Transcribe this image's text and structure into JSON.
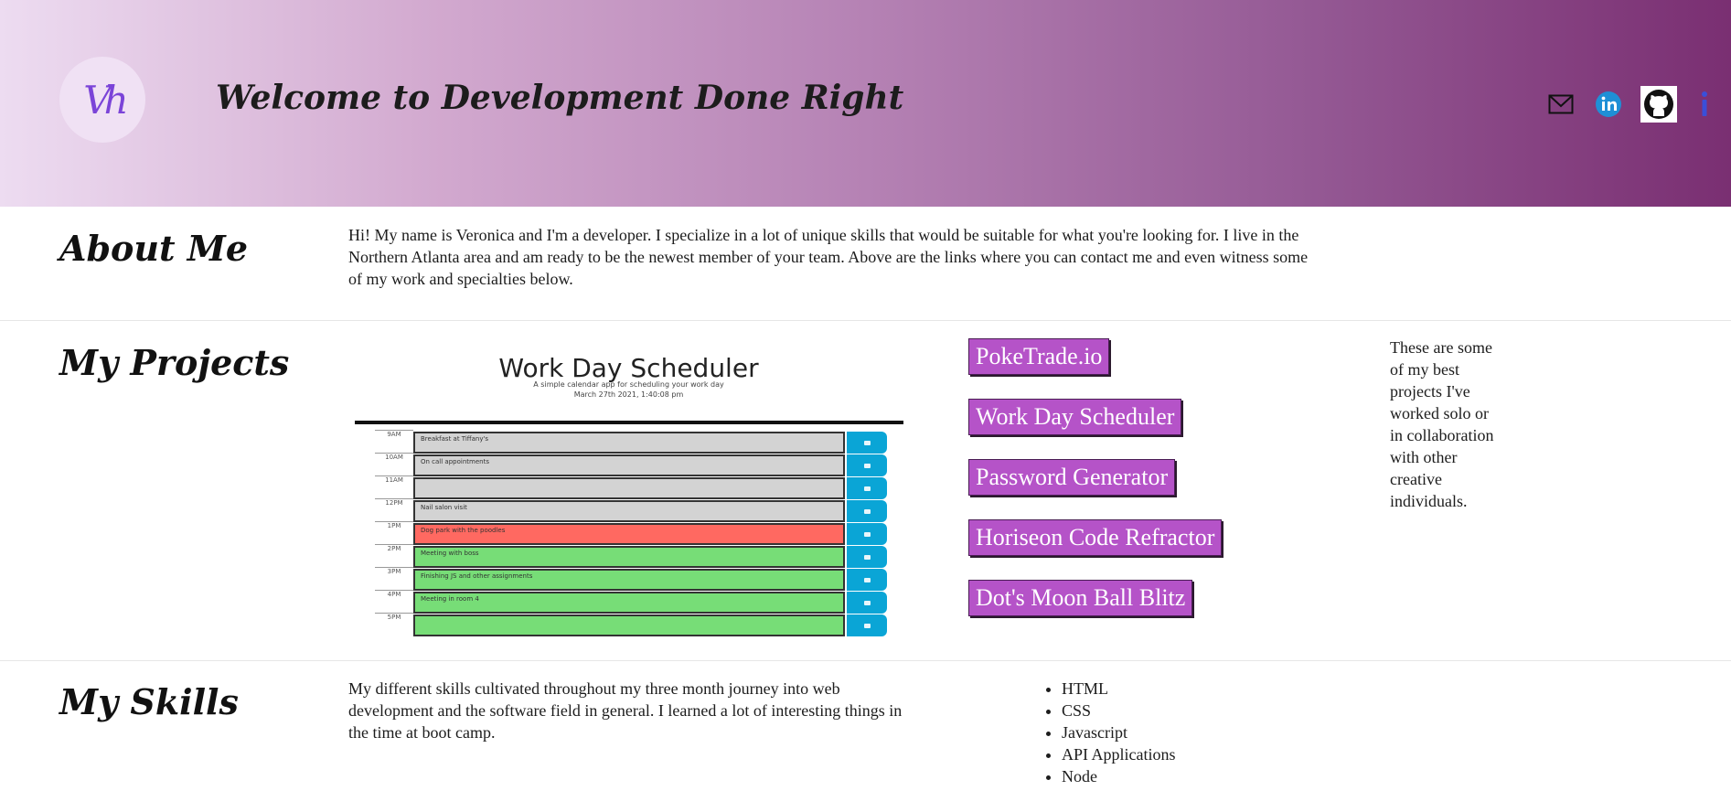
{
  "header": {
    "logo_text": "Vh",
    "title": "Welcome to Development Done Right",
    "icons": [
      "mail-icon",
      "linkedin-icon",
      "github-icon",
      "info-icon"
    ],
    "accent_colors": {
      "gradient_start": "#eddcf1",
      "gradient_end": "#7a2f72",
      "linkedin": "#1f8fd6",
      "info": "#3a4fd9"
    }
  },
  "about": {
    "heading": "About Me",
    "text": "Hi! My name is Veronica and I'm a developer. I specialize in a lot of unique skills that would be suitable for what you're looking for. I live in the Northern Atlanta area and am ready to be the newest member of your team. Above are the links where you can contact me and even witness some of my work and specialties below."
  },
  "projects": {
    "heading": "My Projects",
    "preview": {
      "title": "Work Day Scheduler",
      "subtitle": "A simple calendar app for scheduling your work day",
      "date": "March 27th 2021, 1:40:08 pm",
      "rows": [
        {
          "hour": "9AM",
          "text": "Breakfast at Tiffany's",
          "color": "#d3d3d3"
        },
        {
          "hour": "10AM",
          "text": "On call appointments",
          "color": "#d3d3d3"
        },
        {
          "hour": "11AM",
          "text": "",
          "color": "#d3d3d3"
        },
        {
          "hour": "12PM",
          "text": "Nail salon visit",
          "color": "#d3d3d3"
        },
        {
          "hour": "1PM",
          "text": "Dog park with the poodles",
          "color": "#ff6961"
        },
        {
          "hour": "2PM",
          "text": "Meeting with boss",
          "color": "#77dd77"
        },
        {
          "hour": "3PM",
          "text": "Finishing JS and other assignments",
          "color": "#77dd77"
        },
        {
          "hour": "4PM",
          "text": "Meeting in room 4",
          "color": "#77dd77"
        },
        {
          "hour": "5PM",
          "text": "",
          "color": "#77dd77"
        }
      ],
      "accent": "#0aa5d6"
    },
    "links": [
      "PokeTrade.io",
      "Work Day Scheduler",
      "Password Generator",
      "Horiseon Code Refractor",
      "Dot's Moon Ball Blitz"
    ],
    "link_color": "#b553c8",
    "note": "These are some of my best projects I've worked solo or in collaboration with other creative individuals."
  },
  "skills": {
    "heading": "My Skills",
    "text": "My different skills cultivated throughout my three month journey into web development and the software field in general. I learned a lot of interesting things in the time at boot camp.",
    "items": [
      "HTML",
      "CSS",
      "Javascript",
      "API Applications",
      "Node"
    ]
  }
}
